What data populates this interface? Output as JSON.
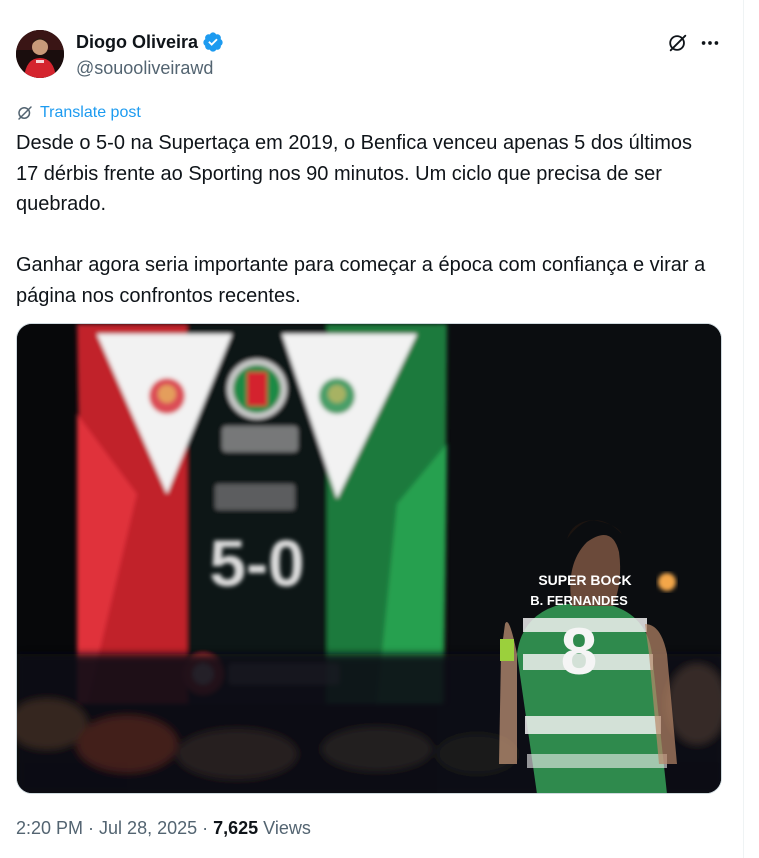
{
  "author": {
    "display_name": "Diogo Oliveira",
    "handle": "@souooliveirawd",
    "verified": true
  },
  "actions": {
    "grok_icon": "grok-icon",
    "more_icon": "more-icon"
  },
  "translate": {
    "label": "Translate post"
  },
  "post": {
    "paragraph_1": "Desde o 5-0 na Supertaça em 2019, o Benfica venceu apenas 5 dos últimos 17 dérbis frente ao Sporting nos 90 minutos. Um ciclo que precisa de ser quebrado.",
    "paragraph_2": "Ganhar agora seria importante para começar a época com confiança e virar a página nos confrontos recentes."
  },
  "media": {
    "scoreboard_score": "5-0",
    "scoreboard_sponsor": "vodafone",
    "jersey_sponsor": "SUPER BOCK",
    "jersey_name": "B. FERNANDES",
    "jersey_number": "8"
  },
  "meta": {
    "time": "2:20 PM",
    "date": "Jul 28, 2025",
    "separator": "·",
    "views_count": "7,625",
    "views_label": "Views"
  },
  "colors": {
    "link": "#1d9bf0",
    "verified": "#1d9bf0",
    "secondary_text": "#536471",
    "benfica_red": "#d4242e",
    "sporting_green": "#1d8a45"
  }
}
